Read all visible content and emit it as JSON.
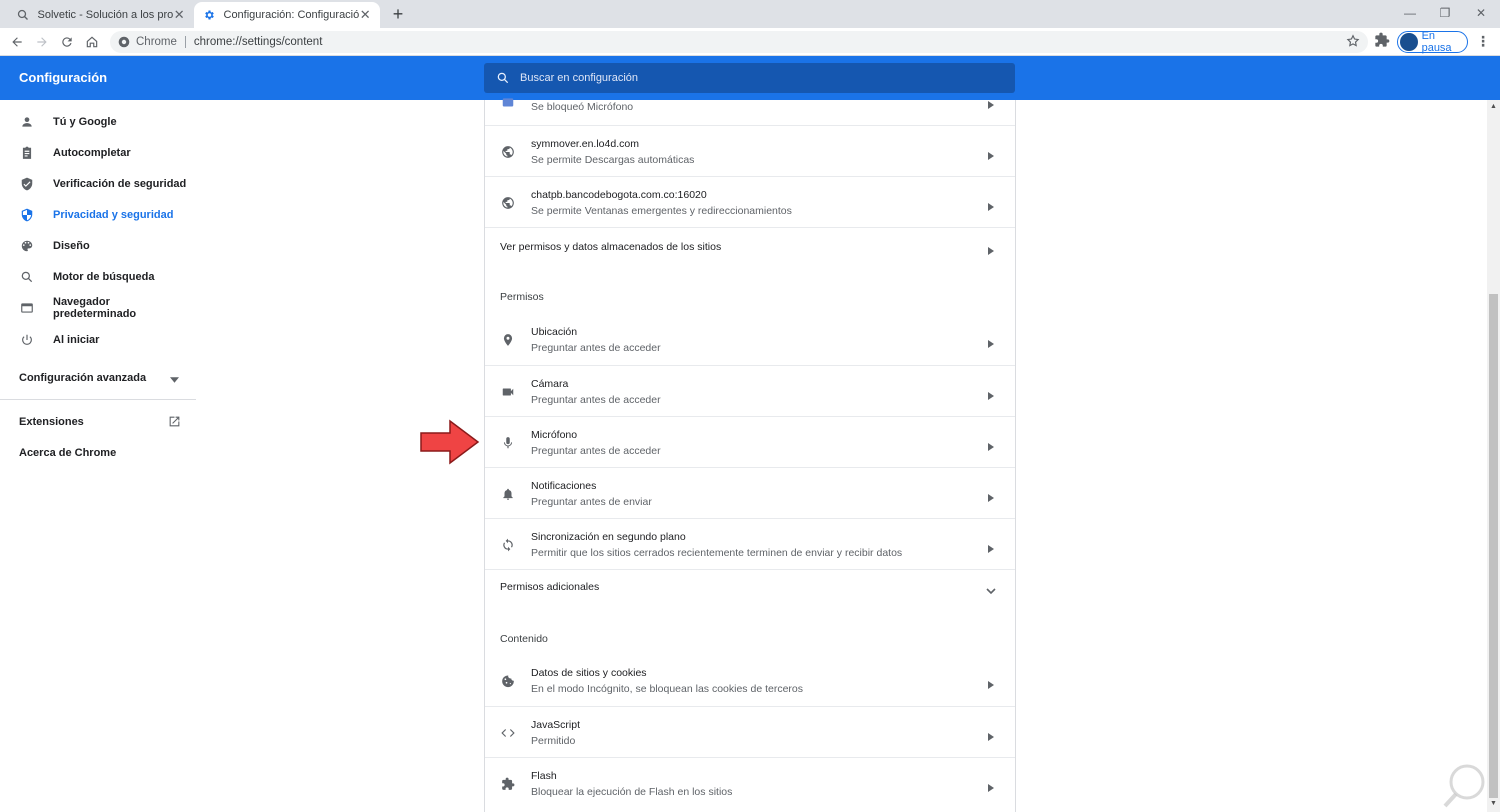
{
  "tabs": [
    {
      "title": "Solvetic - Solución a los problemas",
      "icon": "solvetic-icon"
    },
    {
      "title": "Configuración: Configuración de",
      "icon": "gear-icon"
    }
  ],
  "toolbar": {
    "site_chip": "Chrome",
    "url": "chrome://settings/content",
    "profile_label": "En pausa"
  },
  "header": {
    "title": "Configuración",
    "search_placeholder": "Buscar en configuración"
  },
  "sidebar": {
    "items": [
      {
        "label": "Tú y Google",
        "icon": "person-icon"
      },
      {
        "label": "Autocompletar",
        "icon": "clipboard-icon"
      },
      {
        "label": "Verificación de seguridad",
        "icon": "shield-check-icon"
      },
      {
        "label": "Privacidad y seguridad",
        "icon": "shield-icon",
        "active": true
      },
      {
        "label": "Diseño",
        "icon": "palette-icon"
      },
      {
        "label": "Motor de búsqueda",
        "icon": "search-icon"
      },
      {
        "label": "Navegador predeterminado",
        "icon": "browser-icon"
      },
      {
        "label": "Al iniciar",
        "icon": "power-icon"
      }
    ],
    "advanced": "Configuración avanzada",
    "extensions": "Extensiones",
    "about": "Acerca de Chrome"
  },
  "main": {
    "recent": [
      {
        "title": "",
        "subtitle": "Se bloqueó Micrófono"
      },
      {
        "title": "symmover.en.lo4d.com",
        "subtitle": "Se permite Descargas automáticas"
      },
      {
        "title": "chatpb.bancodebogota.com.co:16020",
        "subtitle": "Se permite Ventanas emergentes y redireccionamientos"
      }
    ],
    "view_all": "Ver permisos y datos almacenados de los sitios",
    "permissions_heading": "Permisos",
    "permissions": [
      {
        "title": "Ubicación",
        "subtitle": "Preguntar antes de acceder",
        "icon": "location-pin-icon"
      },
      {
        "title": "Cámara",
        "subtitle": "Preguntar antes de acceder",
        "icon": "camera-icon"
      },
      {
        "title": "Micrófono",
        "subtitle": "Preguntar antes de acceder",
        "icon": "microphone-icon"
      },
      {
        "title": "Notificaciones",
        "subtitle": "Preguntar antes de enviar",
        "icon": "bell-icon"
      },
      {
        "title": "Sincronización en segundo plano",
        "subtitle": "Permitir que los sitios cerrados recientemente terminen de enviar y recibir datos",
        "icon": "sync-icon"
      }
    ],
    "additional_permissions": "Permisos adicionales",
    "content_heading": "Contenido",
    "content": [
      {
        "title": "Datos de sitios y cookies",
        "subtitle": "En el modo Incógnito, se bloquean las cookies de terceros",
        "icon": "cookie-icon"
      },
      {
        "title": "JavaScript",
        "subtitle": "Permitido",
        "icon": "code-icon"
      },
      {
        "title": "Flash",
        "subtitle": "Bloquear la ejecución de Flash en los sitios",
        "icon": "puzzle-icon"
      }
    ]
  },
  "colors": {
    "accent": "#1a73e8",
    "annotation_arrow": "#ef4444"
  }
}
